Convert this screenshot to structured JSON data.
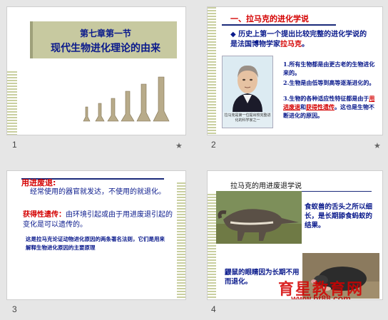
{
  "slides": [
    {
      "number": "1",
      "title_line1": "第七章第一节",
      "title_line2": "现代生物进化理论的由来"
    },
    {
      "number": "2",
      "heading": "一、拉马克的进化学说",
      "intro_part1": "历史上第一个提出比较完整的进化学说的是法国博物学家",
      "intro_name": "拉马克",
      "intro_end": "。",
      "portrait_caption": "拉马克是第一位提出较完整进化的科学家之一",
      "points": [
        "1.所有生物都是由更古老的生物进化来的。",
        "2.生物是由低等到高等逐渐进化的。"
      ],
      "point3_part1": "3.生物的各种适应性特征都是由于",
      "point3_term1": "用进废退",
      "point3_mid": "和",
      "point3_term2": "获得性遗传",
      "point3_end": "。这也是生物不断进化的原因。"
    },
    {
      "number": "3",
      "term1": "用进废退:",
      "def1": "经常使用的器官就发达，不使用的就退化。",
      "term2": "获得性遗传：",
      "def2": "由环境引起或由于用进废退引起的变化是可以遗传的。",
      "summary": "这是拉马克论证动物进化原因的两条著名法则，它们是用来解释生物进化原因的主要原理"
    },
    {
      "number": "4",
      "heading": "拉马克的用进废退学说",
      "anteater_text": "食蚁兽的舌头之所以细长，是长期舔食蚂蚁的结果。",
      "mole_text": "鼹鼠的眼睛因为长期不用而退化。"
    }
  ],
  "watermark": {
    "name": "育星教育网",
    "url": "www.ht88.com"
  },
  "star_glyph": "★",
  "colors": {
    "title_bg": "#c7c9a0",
    "heading_blue": "#0a1a8c",
    "accent_red": "#d40000",
    "stripe": "#c9cfa0"
  }
}
